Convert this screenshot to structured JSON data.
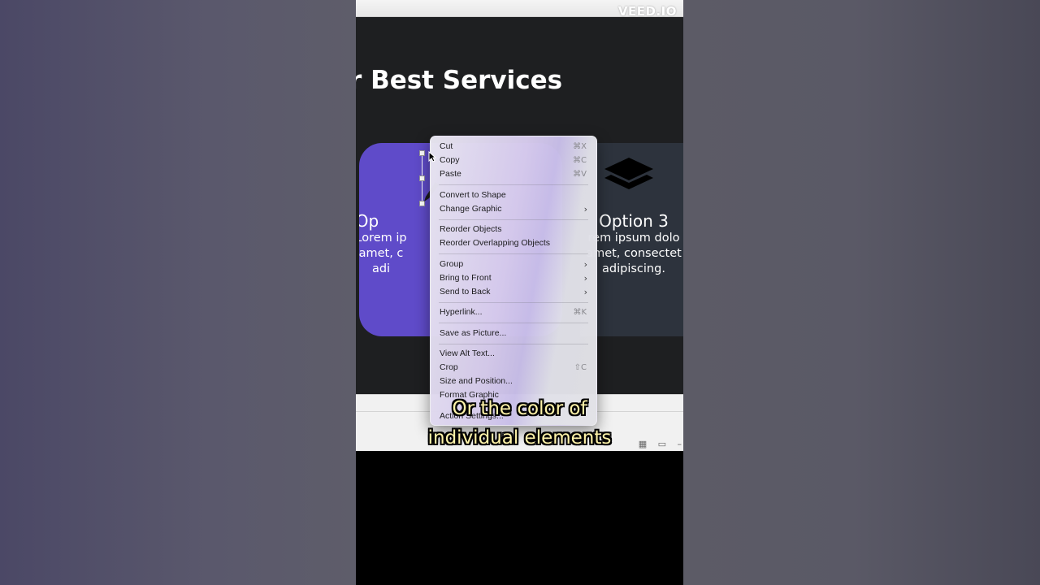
{
  "watermark": "VEED.IO",
  "slide": {
    "title": "r Best Services",
    "cards": [
      {
        "title": "Op",
        "body_lines": [
          "Lorem ip",
          "amet, c",
          "adi"
        ]
      },
      {
        "title": "Option 3",
        "body_lines": [
          "rem ipsum dolo",
          "amet, consectet",
          "adipiscing."
        ]
      }
    ]
  },
  "context_menu": {
    "items": [
      {
        "label": "Cut",
        "shortcut": "⌘X"
      },
      {
        "label": "Copy",
        "shortcut": "⌘C"
      },
      {
        "label": "Paste",
        "shortcut": "⌘V"
      },
      {
        "label": "Convert to Shape",
        "shortcut": ""
      },
      {
        "label": "Change Graphic",
        "shortcut": "",
        "submenu": true
      },
      {
        "label": "Reorder Objects",
        "shortcut": ""
      },
      {
        "label": "Reorder Overlapping Objects",
        "shortcut": ""
      },
      {
        "label": "Group",
        "shortcut": "",
        "submenu": true
      },
      {
        "label": "Bring to Front",
        "shortcut": "",
        "submenu": true
      },
      {
        "label": "Send to Back",
        "shortcut": "",
        "submenu": true
      },
      {
        "label": "Hyperlink...",
        "shortcut": "⌘K"
      },
      {
        "label": "Save as Picture...",
        "shortcut": ""
      },
      {
        "label": "View Alt Text...",
        "shortcut": ""
      },
      {
        "label": "Crop",
        "shortcut": "⇧C"
      },
      {
        "label": "Size and Position...",
        "shortcut": ""
      },
      {
        "label": "Format Graphic",
        "shortcut": ""
      },
      {
        "label": "Action Settings...",
        "shortcut": ""
      }
    ]
  },
  "caption": {
    "line1": "Or the color of",
    "line2": "individual elements"
  },
  "colors": {
    "card_purple": "#5f4bc9",
    "card_dark": "#2d333d",
    "caption_yellow": "#fff3a8"
  }
}
